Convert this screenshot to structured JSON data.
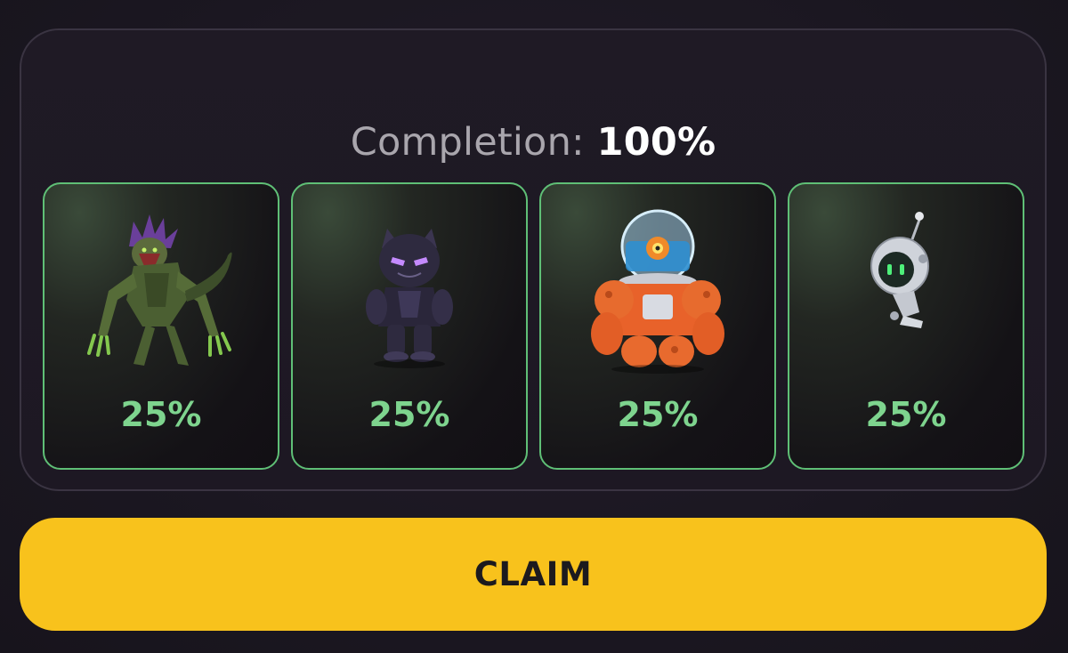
{
  "completion": {
    "label": "Completion:",
    "value": "100%"
  },
  "cards": [
    {
      "character_icon": "beast-monster-icon",
      "percent": "25%"
    },
    {
      "character_icon": "panther-hero-icon",
      "percent": "25%"
    },
    {
      "character_icon": "diver-robot-icon",
      "percent": "25%"
    },
    {
      "character_icon": "floating-bot-icon",
      "percent": "25%"
    }
  ],
  "claim_button": {
    "label": "CLAIM"
  },
  "colors": {
    "accent_green": "#7ed48e",
    "card_border": "#5fbf76",
    "claim_yellow": "#f8c21c",
    "background": "#1a1620"
  }
}
